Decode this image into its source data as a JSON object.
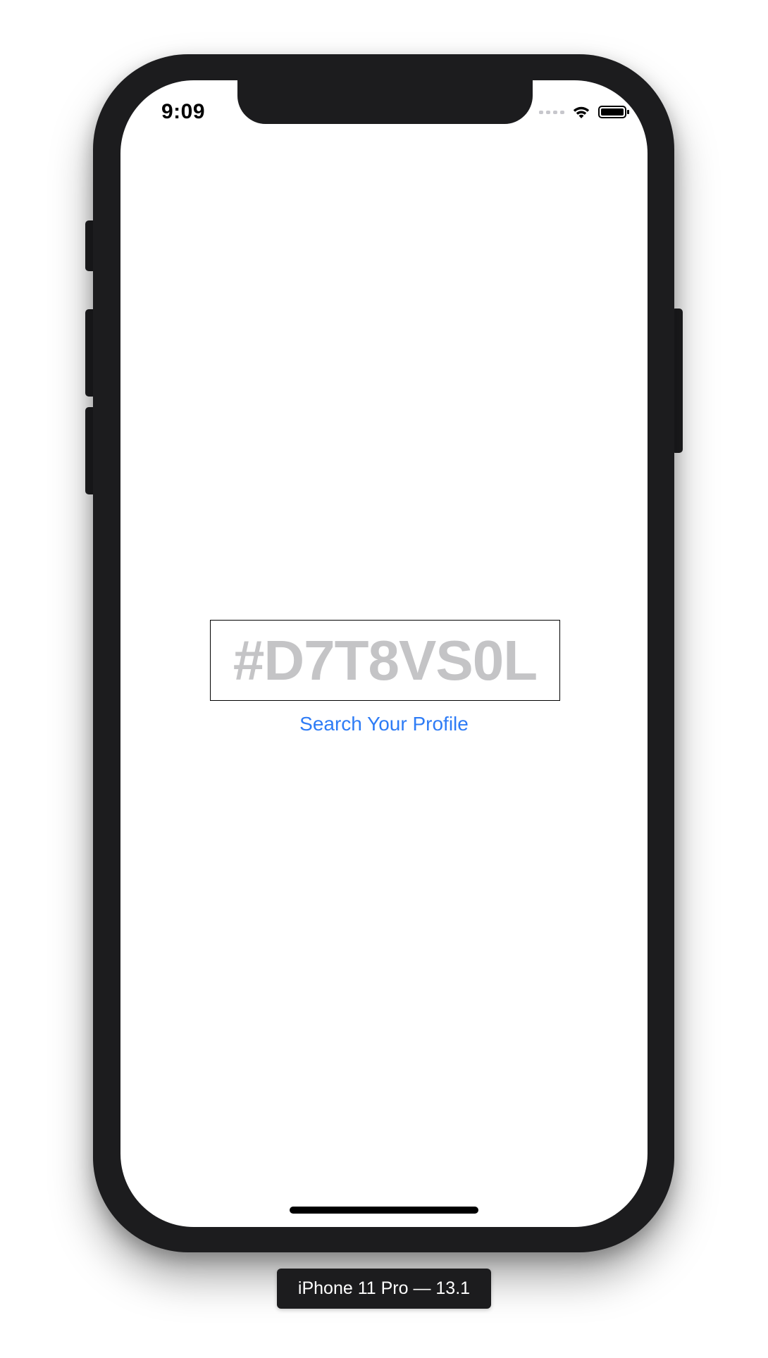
{
  "status_bar": {
    "time": "9:09",
    "icons": [
      "signal-icon",
      "wifi-icon",
      "battery-icon"
    ]
  },
  "main": {
    "code_value": "#D7T8VS0L",
    "search_link_label": "Search Your Profile"
  },
  "simulator": {
    "device_label": "iPhone 11 Pro — 13.1"
  },
  "colors": {
    "link": "#2e7cf6",
    "code_text": "#c4c4c6",
    "frame": "#1c1c1e"
  }
}
